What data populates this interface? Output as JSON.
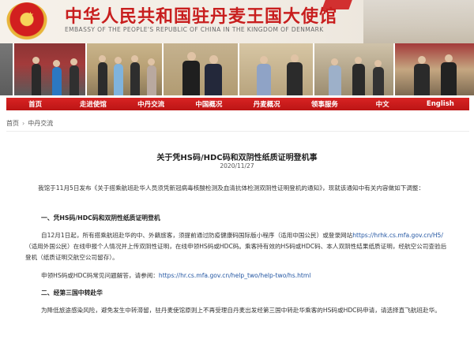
{
  "header": {
    "title_cn": "中华人民共和国驻丹麦王国大使馆",
    "title_en": "EMBASSY OF THE PEOPLE'S REPUBLIC OF CHINA IN THE KINGDOM OF DENMARK"
  },
  "nav": {
    "items": [
      "首页",
      "走进使馆",
      "中丹交流",
      "中国概况",
      "丹麦概况",
      "领事服务",
      "中文",
      "English"
    ]
  },
  "breadcrumb": {
    "home": "首页",
    "separator": "›",
    "current": "中丹交流"
  },
  "article": {
    "title": "关于凭HS码/HDC码和双阴性纸质证明登机事",
    "date": "2020/11/27",
    "intro": "我馆于11月5日发布《关于搭乘航班赴华人员须凭新冠病毒核酸检测及血清抗体检测双阴性证明登机的通知》，现就该通知中有关内容做如下调整：",
    "section1_heading": "一、凭HS码/HDC码和双阴性纸质证明登机",
    "para1_start": "自12月1日起，所有搭乘航班赴华的中、外籍旅客，须提前通过防疫健康码国际版小程序（适用中国公民）或登录网站",
    "para1_link": "https://hrhk.cs.mfa.gov.cn/H5/",
    "para1_end": "（适用外国公民）在线申报个人情况并上传双阴性证明，在线申领HS码或HDC码。乘客持有效的HS码或HDC码、本人双阴性结果纸质证明，经航空公司查验后登机（纸质证明交航空公司留存）。",
    "para2_start": "申领HS码或HDC码常见问题解答，请参阅：",
    "para2_link": "https://hr.cs.mfa.gov.cn/help_two/help-two/hs.html",
    "section2_heading": "二、经第三国中转赴华",
    "para3": "为降低旅途感染风险，避免发生中转滞留，驻丹麦使馆原则上不再受理自丹麦出发经第三国中转赴华乘客的HS码或HDC码申请，请选择直飞航班赴华。"
  },
  "colors": {
    "brand_red": "#c81e1e",
    "nav_red": "#d92323",
    "link_blue": "#2457a3"
  }
}
